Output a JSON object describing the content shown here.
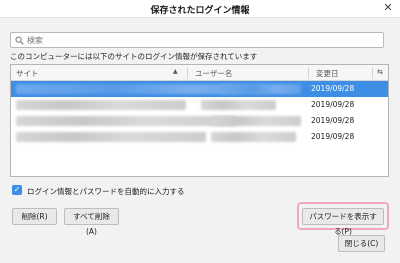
{
  "window": {
    "title": "保存されたログイン情報",
    "close_glyph": "✕"
  },
  "search": {
    "placeholder": "検索"
  },
  "description": "このコンピューターには以下のサイトのログイン情報が保存されています",
  "table": {
    "headers": {
      "site": "サイト",
      "username": "ユーザー名",
      "date": "変更日"
    },
    "sort_indicator": "▲",
    "column_picker_glyph": "⇆",
    "rows": [
      {
        "date": "2019/09/28",
        "selected": true
      },
      {
        "date": "2019/09/28",
        "selected": false
      },
      {
        "date": "2019/09/28",
        "selected": false
      },
      {
        "date": "2019/09/28",
        "selected": false
      }
    ]
  },
  "autofill": {
    "checked": true,
    "label": "ログイン情報とパスワードを自動的に入力する"
  },
  "buttons": {
    "delete": "削除(R)",
    "delete_all": "すべて削除(A)",
    "show_passwords": "パスワードを表示する(P)",
    "close": "閉じる(C)"
  },
  "colors": {
    "selection": "#3e8ee6",
    "highlight_border": "#f2a6c6"
  }
}
